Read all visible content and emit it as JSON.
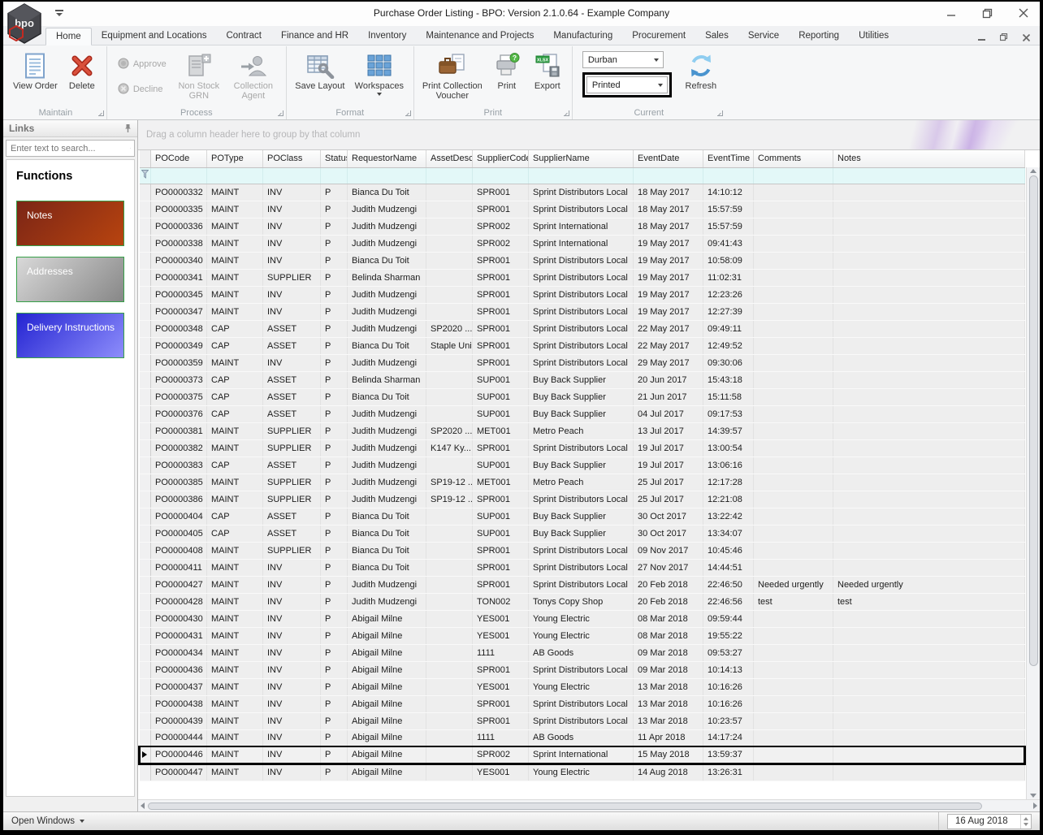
{
  "window": {
    "title": "Purchase Order Listing - BPO: Version 2.1.0.64 - Example Company",
    "logo_text": "bpo"
  },
  "icons": {
    "app-logo": "bpo-hexagon",
    "quick-access-customize": "bar-over-down-caret",
    "minimize": "horizontal-line",
    "restore": "overlapping-squares",
    "close": "x-cross",
    "view-order": "blue-document",
    "delete": "red-x",
    "approve": "gray-disc",
    "decline": "gray-disc",
    "non-stock-grn": "gray-document-plus",
    "collection-agent": "gray-person-arrow",
    "save-layout": "table-with-wrench",
    "workspaces": "blue-tile-grid",
    "print-collection-voucher": "briefcase-with-page",
    "print": "printer-question-badge",
    "export": "xlsx-page-disk",
    "refresh": "blue-circular-arrows",
    "links-pin": "pushpin",
    "search": "magnifier",
    "filter-row": "funnel",
    "sort-ascending": "up-triangle",
    "selected-row-indicator": "right-triangle",
    "dropdown": "down-caret",
    "scrollbar-arrows": "triangles"
  },
  "ribbon": {
    "active_tab": "Home",
    "tabs": [
      "Home",
      "Equipment and Locations",
      "Contract",
      "Finance and HR",
      "Inventory",
      "Maintenance and Projects",
      "Manufacturing",
      "Procurement",
      "Sales",
      "Service",
      "Reporting",
      "Utilities"
    ],
    "groups": {
      "maintain": {
        "label": "Maintain",
        "view_order": "View Order",
        "delete": "Delete"
      },
      "process": {
        "label": "Process",
        "approve": "Approve",
        "decline": "Decline",
        "non_stock_grn": "Non Stock GRN",
        "collection_agent": "Collection Agent"
      },
      "format": {
        "label": "Format",
        "save_layout": "Save Layout",
        "workspaces": "Workspaces"
      },
      "print": {
        "label": "Print",
        "print_collection_voucher": "Print Collection Voucher",
        "print": "Print",
        "export": "Export",
        "export_badge": "XLSX",
        "print_badge": "?"
      },
      "current": {
        "label": "Current",
        "branch_value": "Durban",
        "status_value": "Printed",
        "refresh": "Refresh"
      }
    }
  },
  "sidebar": {
    "title": "Links",
    "search_placeholder": "Enter text to search...",
    "heading": "Functions",
    "functions": [
      {
        "label": "Notes",
        "color_from": "#7b2516",
        "color_to": "#b8440f",
        "border": "#36a048"
      },
      {
        "label": "Addresses",
        "color_from": "#d9d9d9",
        "color_to": "#878787",
        "border": "#36a048"
      },
      {
        "label": "Delivery Instructions",
        "color_from": "#2424d2",
        "color_to": "#8d8dfb",
        "border": "#36a048"
      }
    ]
  },
  "grid": {
    "group_hint": "Drag a column header here to group by that column",
    "selected_po": "PO0000446",
    "columns": [
      {
        "key": "code",
        "label": "POCode",
        "sorted": "asc"
      },
      {
        "key": "type",
        "label": "POType"
      },
      {
        "key": "pclass",
        "label": "POClass"
      },
      {
        "key": "status",
        "label": "Status"
      },
      {
        "key": "requestor",
        "label": "RequestorName"
      },
      {
        "key": "asset",
        "label": "AssetDesc"
      },
      {
        "key": "scode",
        "label": "SupplierCode"
      },
      {
        "key": "sname",
        "label": "SupplierName"
      },
      {
        "key": "date",
        "label": "EventDate"
      },
      {
        "key": "time",
        "label": "EventTime"
      },
      {
        "key": "comments",
        "label": "Comments"
      },
      {
        "key": "notes",
        "label": "Notes"
      }
    ],
    "rows": [
      {
        "code": "PO0000332",
        "type": "MAINT",
        "pclass": "INV",
        "status": "P",
        "requestor": "Bianca Du Toit",
        "asset": "",
        "scode": "SPR001",
        "sname": "Sprint Distributors Local",
        "date": "18 May 2017",
        "time": "14:10:12",
        "comments": "",
        "notes": ""
      },
      {
        "code": "PO0000335",
        "type": "MAINT",
        "pclass": "INV",
        "status": "P",
        "requestor": "Judith Mudzengi",
        "asset": "",
        "scode": "SPR001",
        "sname": "Sprint Distributors Local",
        "date": "18 May 2017",
        "time": "15:57:59",
        "comments": "",
        "notes": ""
      },
      {
        "code": "PO0000336",
        "type": "MAINT",
        "pclass": "INV",
        "status": "P",
        "requestor": "Judith Mudzengi",
        "asset": "",
        "scode": "SPR002",
        "sname": "Sprint International",
        "date": "18 May 2017",
        "time": "15:57:59",
        "comments": "",
        "notes": ""
      },
      {
        "code": "PO0000338",
        "type": "MAINT",
        "pclass": "INV",
        "status": "P",
        "requestor": "Judith Mudzengi",
        "asset": "",
        "scode": "SPR002",
        "sname": "Sprint International",
        "date": "19 May 2017",
        "time": "09:41:43",
        "comments": "",
        "notes": ""
      },
      {
        "code": "PO0000340",
        "type": "MAINT",
        "pclass": "INV",
        "status": "P",
        "requestor": "Bianca Du Toit",
        "asset": "",
        "scode": "SPR001",
        "sname": "Sprint Distributors Local",
        "date": "19 May 2017",
        "time": "10:58:09",
        "comments": "",
        "notes": ""
      },
      {
        "code": "PO0000341",
        "type": "MAINT",
        "pclass": "SUPPLIER",
        "status": "P",
        "requestor": "Belinda Sharman",
        "asset": "",
        "scode": "SPR001",
        "sname": "Sprint Distributors Local",
        "date": "19 May 2017",
        "time": "11:02:31",
        "comments": "",
        "notes": ""
      },
      {
        "code": "PO0000345",
        "type": "MAINT",
        "pclass": "INV",
        "status": "P",
        "requestor": "Judith Mudzengi",
        "asset": "",
        "scode": "SPR001",
        "sname": "Sprint Distributors Local",
        "date": "19 May 2017",
        "time": "12:23:26",
        "comments": "",
        "notes": ""
      },
      {
        "code": "PO0000347",
        "type": "MAINT",
        "pclass": "INV",
        "status": "P",
        "requestor": "Judith Mudzengi",
        "asset": "",
        "scode": "SPR001",
        "sname": "Sprint Distributors Local",
        "date": "19 May 2017",
        "time": "12:27:39",
        "comments": "",
        "notes": ""
      },
      {
        "code": "PO0000348",
        "type": "CAP",
        "pclass": "ASSET",
        "status": "P",
        "requestor": "Judith Mudzengi",
        "asset": "SP2020 ...",
        "scode": "SPR001",
        "sname": "Sprint Distributors Local",
        "date": "22 May 2017",
        "time": "09:49:11",
        "comments": "",
        "notes": ""
      },
      {
        "code": "PO0000349",
        "type": "CAP",
        "pclass": "ASSET",
        "status": "P",
        "requestor": "Bianca Du Toit",
        "asset": "Staple Unit",
        "scode": "SPR001",
        "sname": "Sprint Distributors Local",
        "date": "22 May 2017",
        "time": "12:49:52",
        "comments": "",
        "notes": ""
      },
      {
        "code": "PO0000359",
        "type": "MAINT",
        "pclass": "INV",
        "status": "P",
        "requestor": "Judith Mudzengi",
        "asset": "",
        "scode": "SPR001",
        "sname": "Sprint Distributors Local",
        "date": "29 May 2017",
        "time": "09:30:06",
        "comments": "",
        "notes": ""
      },
      {
        "code": "PO0000373",
        "type": "CAP",
        "pclass": "ASSET",
        "status": "P",
        "requestor": "Belinda Sharman",
        "asset": "",
        "scode": "SUP001",
        "sname": "Buy Back Supplier",
        "date": "20 Jun 2017",
        "time": "15:43:18",
        "comments": "",
        "notes": ""
      },
      {
        "code": "PO0000375",
        "type": "CAP",
        "pclass": "ASSET",
        "status": "P",
        "requestor": "Bianca Du Toit",
        "asset": "",
        "scode": "SUP001",
        "sname": "Buy Back Supplier",
        "date": "21 Jun 2017",
        "time": "15:11:58",
        "comments": "",
        "notes": ""
      },
      {
        "code": "PO0000376",
        "type": "CAP",
        "pclass": "ASSET",
        "status": "P",
        "requestor": "Judith Mudzengi",
        "asset": "",
        "scode": "SUP001",
        "sname": "Buy Back Supplier",
        "date": "04 Jul 2017",
        "time": "09:17:53",
        "comments": "",
        "notes": ""
      },
      {
        "code": "PO0000381",
        "type": "MAINT",
        "pclass": "SUPPLIER",
        "status": "P",
        "requestor": "Judith Mudzengi",
        "asset": "SP2020 ...",
        "scode": "MET001",
        "sname": "Metro Peach",
        "date": "13 Jul 2017",
        "time": "14:39:57",
        "comments": "",
        "notes": ""
      },
      {
        "code": "PO0000382",
        "type": "MAINT",
        "pclass": "SUPPLIER",
        "status": "P",
        "requestor": "Judith Mudzengi",
        "asset": "K147 Ky...",
        "scode": "SPR001",
        "sname": "Sprint Distributors Local",
        "date": "19 Jul 2017",
        "time": "13:00:54",
        "comments": "",
        "notes": ""
      },
      {
        "code": "PO0000383",
        "type": "CAP",
        "pclass": "ASSET",
        "status": "P",
        "requestor": "Judith Mudzengi",
        "asset": "",
        "scode": "SUP001",
        "sname": "Buy Back Supplier",
        "date": "19 Jul 2017",
        "time": "13:06:16",
        "comments": "",
        "notes": ""
      },
      {
        "code": "PO0000385",
        "type": "MAINT",
        "pclass": "SUPPLIER",
        "status": "P",
        "requestor": "Judith Mudzengi",
        "asset": "SP19-12 ...",
        "scode": "MET001",
        "sname": "Metro Peach",
        "date": "25 Jul 2017",
        "time": "12:17:28",
        "comments": "",
        "notes": ""
      },
      {
        "code": "PO0000386",
        "type": "MAINT",
        "pclass": "SUPPLIER",
        "status": "P",
        "requestor": "Judith Mudzengi",
        "asset": "SP19-12 ...",
        "scode": "SPR001",
        "sname": "Sprint Distributors Local",
        "date": "25 Jul 2017",
        "time": "12:21:08",
        "comments": "",
        "notes": ""
      },
      {
        "code": "PO0000404",
        "type": "CAP",
        "pclass": "ASSET",
        "status": "P",
        "requestor": "Bianca Du Toit",
        "asset": "",
        "scode": "SUP001",
        "sname": "Buy Back Supplier",
        "date": "30 Oct 2017",
        "time": "13:22:42",
        "comments": "",
        "notes": ""
      },
      {
        "code": "PO0000405",
        "type": "CAP",
        "pclass": "ASSET",
        "status": "P",
        "requestor": "Bianca Du Toit",
        "asset": "",
        "scode": "SUP001",
        "sname": "Buy Back Supplier",
        "date": "30 Oct 2017",
        "time": "13:34:07",
        "comments": "",
        "notes": ""
      },
      {
        "code": "PO0000408",
        "type": "MAINT",
        "pclass": "SUPPLIER",
        "status": "P",
        "requestor": "Bianca Du Toit",
        "asset": "",
        "scode": "SPR001",
        "sname": "Sprint Distributors Local",
        "date": "09 Nov 2017",
        "time": "10:45:46",
        "comments": "",
        "notes": ""
      },
      {
        "code": "PO0000411",
        "type": "MAINT",
        "pclass": "INV",
        "status": "P",
        "requestor": "Bianca Du Toit",
        "asset": "",
        "scode": "SPR001",
        "sname": "Sprint Distributors Local",
        "date": "27 Nov 2017",
        "time": "14:44:51",
        "comments": "",
        "notes": ""
      },
      {
        "code": "PO0000427",
        "type": "MAINT",
        "pclass": "INV",
        "status": "P",
        "requestor": "Judith Mudzengi",
        "asset": "",
        "scode": "SPR001",
        "sname": "Sprint Distributors Local",
        "date": "20 Feb 2018",
        "time": "22:46:50",
        "comments": "Needed urgently",
        "notes": "Needed urgently"
      },
      {
        "code": "PO0000428",
        "type": "MAINT",
        "pclass": "INV",
        "status": "P",
        "requestor": "Judith Mudzengi",
        "asset": "",
        "scode": "TON002",
        "sname": "Tonys Copy Shop",
        "date": "20 Feb 2018",
        "time": "22:46:56",
        "comments": "test",
        "notes": "test"
      },
      {
        "code": "PO0000430",
        "type": "MAINT",
        "pclass": "INV",
        "status": "P",
        "requestor": "Abigail Milne",
        "asset": "",
        "scode": "YES001",
        "sname": "Young Electric",
        "date": "08 Mar 2018",
        "time": "09:59:44",
        "comments": "",
        "notes": ""
      },
      {
        "code": "PO0000431",
        "type": "MAINT",
        "pclass": "INV",
        "status": "P",
        "requestor": "Abigail Milne",
        "asset": "",
        "scode": "YES001",
        "sname": "Young Electric",
        "date": "08 Mar 2018",
        "time": "19:55:22",
        "comments": "",
        "notes": ""
      },
      {
        "code": "PO0000434",
        "type": "MAINT",
        "pclass": "INV",
        "status": "P",
        "requestor": "Abigail Milne",
        "asset": "",
        "scode": "1111",
        "sname": "AB Goods",
        "date": "09 Mar 2018",
        "time": "09:53:27",
        "comments": "",
        "notes": ""
      },
      {
        "code": "PO0000436",
        "type": "MAINT",
        "pclass": "INV",
        "status": "P",
        "requestor": "Abigail Milne",
        "asset": "",
        "scode": "SPR001",
        "sname": "Sprint Distributors Local",
        "date": "09 Mar 2018",
        "time": "10:14:13",
        "comments": "",
        "notes": ""
      },
      {
        "code": "PO0000437",
        "type": "MAINT",
        "pclass": "INV",
        "status": "P",
        "requestor": "Abigail Milne",
        "asset": "",
        "scode": "YES001",
        "sname": "Young Electric",
        "date": "13 Mar 2018",
        "time": "10:16:26",
        "comments": "",
        "notes": ""
      },
      {
        "code": "PO0000438",
        "type": "MAINT",
        "pclass": "INV",
        "status": "P",
        "requestor": "Abigail Milne",
        "asset": "",
        "scode": "SPR001",
        "sname": "Sprint Distributors Local",
        "date": "13 Mar 2018",
        "time": "10:16:26",
        "comments": "",
        "notes": ""
      },
      {
        "code": "PO0000439",
        "type": "MAINT",
        "pclass": "INV",
        "status": "P",
        "requestor": "Abigail Milne",
        "asset": "",
        "scode": "SPR001",
        "sname": "Sprint Distributors Local",
        "date": "13 Mar 2018",
        "time": "10:23:57",
        "comments": "",
        "notes": ""
      },
      {
        "code": "PO0000444",
        "type": "MAINT",
        "pclass": "INV",
        "status": "P",
        "requestor": "Abigail Milne",
        "asset": "",
        "scode": "1111",
        "sname": "AB Goods",
        "date": "11 Apr 2018",
        "time": "14:17:24",
        "comments": "",
        "notes": ""
      },
      {
        "code": "PO0000446",
        "type": "MAINT",
        "pclass": "INV",
        "status": "P",
        "requestor": "Abigail Milne",
        "asset": "",
        "scode": "SPR002",
        "sname": "Sprint International",
        "date": "15 May 2018",
        "time": "13:59:37",
        "comments": "",
        "notes": ""
      },
      {
        "code": "PO0000447",
        "type": "MAINT",
        "pclass": "INV",
        "status": "P",
        "requestor": "Abigail Milne",
        "asset": "",
        "scode": "YES001",
        "sname": "Young Electric",
        "date": "14 Aug 2018",
        "time": "13:26:31",
        "comments": "",
        "notes": ""
      }
    ]
  },
  "status_bar": {
    "open_windows": "Open Windows",
    "date": "16 Aug 2018"
  },
  "colors": {
    "annotation": "#000000",
    "filter_row": "#e3f8f8",
    "accent_blue": "#5b9bd5"
  }
}
